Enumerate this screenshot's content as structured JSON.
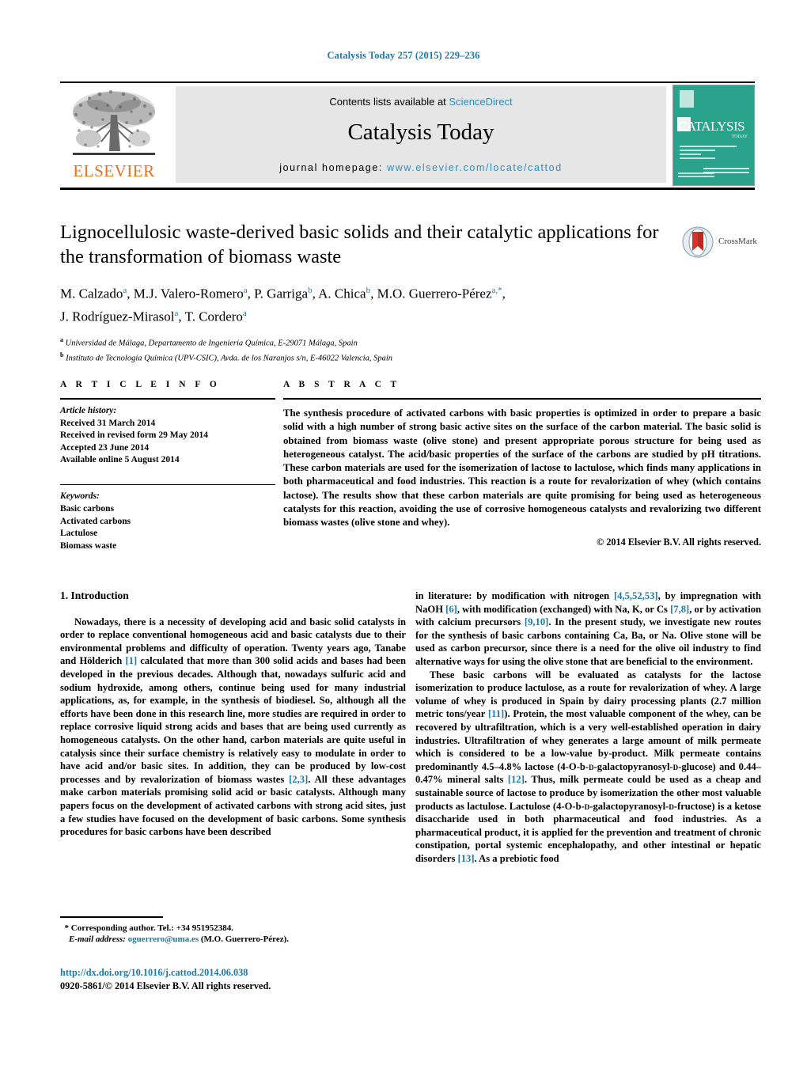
{
  "running_head": "Catalysis Today 257 (2015) 229–236",
  "masthead": {
    "publisher_name": "ELSEVIER",
    "contents_prefix": "Contents lists available at ",
    "contents_link": "ScienceDirect",
    "journal_name": "Catalysis Today",
    "homepage_prefix": "journal homepage: ",
    "homepage_url": "www.elsevier.com/locate/cattod",
    "cover_title": "CATALYSIS",
    "cover_subtitle": "TODAY"
  },
  "article": {
    "title": "Lignocellulosic waste-derived basic solids and their catalytic applications for the transformation of biomass waste",
    "authors_line1": "M. Calzado",
    "authors_line1_full": "M. Calzado a, M.J. Valero-Romero a, P. Garriga b, A. Chica b, M.O. Guerrero-Pérez a,*,",
    "authors_line2_full": "J. Rodríguez-Mirasol a, T. Cordero a",
    "affiliation_a": "Universidad de Málaga, Departamento de Ingeniería Química, E-29071 Málaga, Spain",
    "affiliation_b": "Instituto de Tecnología Química (UPV-CSIC), Avda. de los Naranjos s/n, E-46022 Valencia, Spain",
    "crossmark_label": "CrossMark"
  },
  "article_info": {
    "heading": "A R T I C L E   I N F O",
    "history_label": "Article history:",
    "history": [
      "Received 31 March 2014",
      "Received in revised form 29 May 2014",
      "Accepted 23 June 2014",
      "Available online 5 August 2014"
    ],
    "keywords_label": "Keywords:",
    "keywords": [
      "Basic carbons",
      "Activated carbons",
      "Lactulose",
      "Biomass waste"
    ]
  },
  "abstract": {
    "heading": "A B S T R A C T",
    "text": "The synthesis procedure of activated carbons with basic properties is optimized in order to prepare a basic solid with a high number of strong basic active sites on the surface of the carbon material. The basic solid is obtained from biomass waste (olive stone) and present appropriate porous structure for being used as heterogeneous catalyst. The acid/basic properties of the surface of the carbons are studied by pH titrations. These carbon materials are used for the isomerization of lactose to lactulose, which finds many applications in both pharmaceutical and food industries. This reaction is a route for revalorization of whey (which contains lactose). The results show that these carbon materials are quite promising for being used as heterogeneous catalysts for this reaction, avoiding the use of corrosive homogeneous catalysts and revalorizing two different biomass wastes (olive stone and whey).",
    "copyright": "© 2014 Elsevier B.V. All rights reserved."
  },
  "body": {
    "section_heading": "1.  Introduction",
    "left_p1_a": "Nowadays, there is a necessity of developing acid and basic solid catalysts in order to replace conventional homogeneous acid and basic catalysts due to their environmental problems and difficulty of operation. Twenty years ago, Tanabe and Hölderich ",
    "left_p1_ref1": "[1]",
    "left_p1_b": " calculated that more than 300 solid acids and bases had been developed in the previous decades. Although that, nowadays sulfuric acid and sodium hydroxide, among others, continue being used for many industrial applications, as, for example, in the synthesis of biodiesel. So, although all the efforts have been done in this research line, more studies are required in order to replace corrosive liquid strong acids and bases that are being used currently as homogeneous catalysts. On the other hand, carbon materials are quite useful in catalysis since their surface chemistry is relatively easy to modulate in order to have acid and/or basic sites. In addition, they can be produced by low-cost processes and by revalorization of biomass wastes ",
    "left_p1_ref2": "[2,3]",
    "left_p1_c": ". All these advantages make carbon materials promising solid acid or basic catalysts. Although many papers focus on the development of activated carbons with strong acid sites, just a few studies have focused on the development of basic carbons. Some synthesis procedures for basic carbons have been described",
    "right_p1_a": "in literature: by modification with nitrogen ",
    "right_p1_ref1": "[4,5,52,53]",
    "right_p1_b": ", by impregnation with NaOH ",
    "right_p1_ref2": "[6]",
    "right_p1_c": ", with modification (exchanged) with Na, K, or Cs ",
    "right_p1_ref3": "[7,8]",
    "right_p1_d": ", or by activation with calcium precursors ",
    "right_p1_ref4": "[9,10]",
    "right_p1_e": ". In the present study, we investigate new routes for the synthesis of basic carbons containing Ca, Ba, or Na. Olive stone will be used as carbon precursor, since there is a need for the olive oil industry to find alternative ways for using the olive stone that are beneficial to the environment.",
    "right_p2_a": "These basic carbons will be evaluated as catalysts for the lactose isomerization to produce lactulose, as a route for revalorization of whey. A large volume of whey is produced in Spain by dairy processing plants (2.7 million metric tons/year ",
    "right_p2_ref1": "[11]",
    "right_p2_b": "). Protein, the most valuable component of the whey, can be recovered by ultrafiltration, which is a very well-established operation in dairy industries. Ultrafiltration of whey generates a large amount of milk permeate which is considered to be a low-value by-product. Milk permeate contains predominantly 4.5–4.8% lactose (4-O-b-",
    "right_p2_sc1": "d",
    "right_p2_c": "-galactopyranosyl-",
    "right_p2_sc2": "d",
    "right_p2_d": "-glucose) and 0.44–0.47% mineral salts ",
    "right_p2_ref2": "[12]",
    "right_p2_e": ". Thus, milk permeate could be used as a cheap and sustainable source of lactose to produce by isomerization the other most valuable products as lactulose. Lactulose (4-O-b-",
    "right_p2_sc3": "d",
    "right_p2_f": "-galactopyranosyl-",
    "right_p2_sc4": "d",
    "right_p2_g": "-fructose) is a ketose disaccharide used in both pharmaceutical and food industries. As a pharmaceutical product, it is applied for the prevention and treatment of chronic constipation, portal systemic encephalopathy, and other intestinal or hepatic disorders ",
    "right_p2_ref3": "[13]",
    "right_p2_h": ". As a prebiotic food"
  },
  "footer": {
    "corresponding_marker": "*",
    "corresponding_text": "Corresponding author. Tel.: +34 951952384.",
    "email_label": "E-mail address:",
    "email": "oguerrero@uma.es",
    "email_owner": "(M.O. Guerrero-Pérez).",
    "doi": "http://dx.doi.org/10.1016/j.cattod.2014.06.038",
    "issn": "0920-5861/© 2014 Elsevier B.V. All rights reserved."
  },
  "colors": {
    "link": "#1a7aa8",
    "elsevier_orange": "#E9711C",
    "cover_teal": "#2aa38c",
    "panel_gray": "#e6e6e6"
  }
}
